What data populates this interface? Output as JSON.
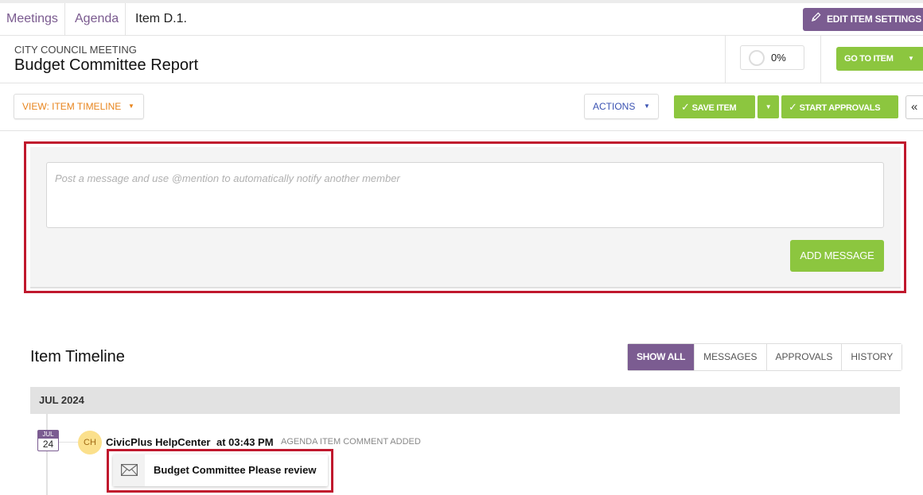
{
  "breadcrumb": {
    "meetings": "Meetings",
    "agenda": "Agenda",
    "item": "Item D.1."
  },
  "header": {
    "edit_settings": "EDIT ITEM SETTINGS",
    "meeting_label": "CITY COUNCIL MEETING",
    "item_title": "Budget Committee Report",
    "progress": "0%",
    "go_to_item": "GO TO ITEM"
  },
  "toolbar": {
    "view": "VIEW: ITEM TIMELINE",
    "actions": "ACTIONS",
    "save_item": "SAVE ITEM",
    "start_approvals": "START APPROVALS",
    "collapse": "«"
  },
  "message": {
    "placeholder": "Post a message and use @mention to automatically notify another member",
    "value": "",
    "add_button": "ADD MESSAGE"
  },
  "timeline": {
    "title": "Item Timeline",
    "filters": [
      "SHOW ALL",
      "MESSAGES",
      "APPROVALS",
      "HISTORY"
    ],
    "active_filter": "SHOW ALL",
    "month": "JUL 2024",
    "entries": [
      {
        "date_month": "JUL",
        "date_day": "24",
        "initials": "CH",
        "author": "CivicPlus HelpCenter",
        "time": "at 03:43 PM",
        "type": "AGENDA ITEM COMMENT ADDED",
        "comment": "Budget Committee Please review"
      }
    ]
  },
  "colors": {
    "purple": "#7b5c91",
    "green": "#8cc63f",
    "orange": "#e8841c",
    "blue": "#3a52b2",
    "highlight_red": "#c0182d"
  }
}
